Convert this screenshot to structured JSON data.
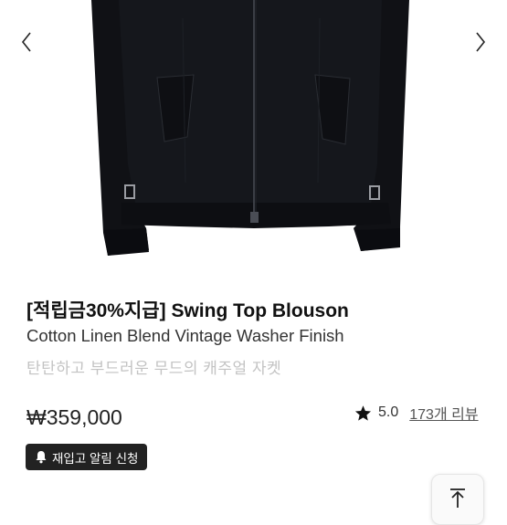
{
  "product": {
    "title": "[적립금30%지급] Swing Top Blouson",
    "subtitle": "Cotton Linen Blend Vintage Washer Finish",
    "description": "탄탄하고 부드러운 무드의 캐주얼 자켓",
    "price": "₩359,000",
    "rating": "5.0",
    "reviews_label": "173개 리뷰",
    "image_name": "black-blouson-jacket"
  },
  "gallery": {
    "prev_icon": "chevron-left-icon",
    "next_icon": "chevron-right-icon"
  },
  "restock": {
    "label": "재입고 알림 신청",
    "icon": "bell-icon"
  },
  "scroll_top": {
    "icon": "arrow-up-to-top-icon"
  },
  "colors": {
    "jacket": "#15171c",
    "button_bg": "#222222",
    "muted_text": "#c3c3c3"
  }
}
